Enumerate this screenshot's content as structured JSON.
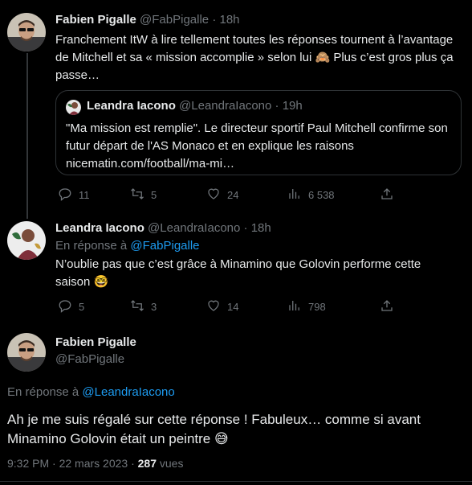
{
  "tweets": [
    {
      "name": "Fabien Pigalle",
      "handle": "@FabPigalle",
      "time": "18h",
      "text": "Franchement ItW à lire tellement toutes les réponses tournent à l’avantage de Mitchell et sa « mission accomplie » selon lui 🙈 Plus c’est gros plus ça passe…",
      "quote": {
        "name": "Leandra Iacono",
        "handle": "@LeandraIacono",
        "time": "19h",
        "text": "\"Ma mission est remplie\". Le directeur sportif Paul Mitchell confirme son futur départ de l'AS Monaco et en explique les raisons",
        "link": "nicematin.com/football/ma-mi…"
      },
      "actions": {
        "replies": "11",
        "retweets": "5",
        "likes": "24",
        "views": "6 538"
      }
    },
    {
      "name": "Leandra Iacono",
      "handle": "@LeandraIacono",
      "time": "18h",
      "reply_prefix": "En réponse à",
      "reply_to": "@FabPigalle",
      "text": "N’oublie pas que c’est grâce à Minamino que Golovin performe cette saison 🤓",
      "actions": {
        "replies": "5",
        "retweets": "3",
        "likes": "14",
        "views": "798"
      }
    }
  ],
  "main_tweet": {
    "name": "Fabien Pigalle",
    "handle": "@FabPigalle",
    "reply_prefix": "En réponse à",
    "reply_to": "@LeandraIacono",
    "text": "Ah je me suis régalé sur cette réponse ! Fabuleux… comme si avant Minamino Golovin était un peintre 😅",
    "timestamp": "9:32 PM · 22 mars 2023 ·",
    "views_count": "287",
    "views_label": "vues"
  },
  "separator": "·",
  "icons": [
    "reply-icon",
    "retweet-icon",
    "like-icon",
    "views-icon",
    "share-icon"
  ],
  "colors": {
    "background": "#000000",
    "text": "#e7e9ea",
    "muted": "#71767b",
    "link": "#1d9bf0",
    "border": "#2f3336"
  }
}
